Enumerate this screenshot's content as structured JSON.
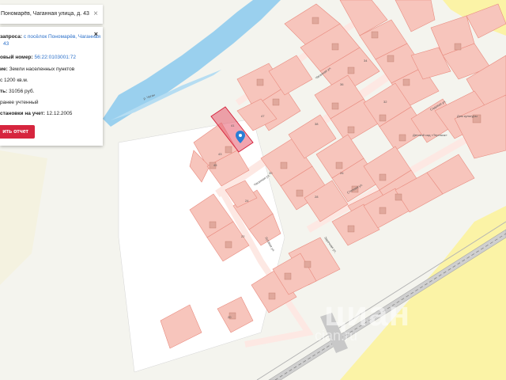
{
  "search": {
    "address": "Пономарёв, Чаганная улица, д. 43",
    "close_icon": "×"
  },
  "panel": {
    "close_icon": "×",
    "request_label": "запроса:",
    "request_value": "с посёлок Пономарёв, Чаганная",
    "request_value2": "43",
    "cadnum_label": "овый номер:",
    "cadnum_value": "56:22:0103001:72",
    "category_label": "ие:",
    "category_value": "Земли населенных пунктов",
    "area_label": "",
    "area_value": "с 1200 кв.м.",
    "cost_label": "ть:",
    "cost_value": "31056 руб.",
    "status_value": "ранее учтенный",
    "date_label": "становки на учет:",
    "date_value": "12.12.2005",
    "button_label": "ить отчет"
  },
  "map_labels": {
    "street1": "Чаганная ул.",
    "street2": "Чаганная ул.",
    "street3": "Степная ул.",
    "street4": "Садовая ул.",
    "street5": "Луговая ул.",
    "street6": "Заречная ул.",
    "river": "р. Чаган",
    "poi1": "Детский сад «Теремок»",
    "poi2": "Дом культуры",
    "n1": "41",
    "n2": "43",
    "n3": "45",
    "n4": "47",
    "n5": "38",
    "n6": "36",
    "n7": "34",
    "n8": "32",
    "n9": "30",
    "n10": "28",
    "n11": "26",
    "n12": "24",
    "n13": "22",
    "n14": "20"
  },
  "watermark": {
    "main": "циан",
    "sub": "cian.ru"
  },
  "colors": {
    "parcel": "#f7c5bc",
    "parcel_stroke": "#e88a7e",
    "selected": "#e65a6e",
    "river": "#9ad0ee",
    "field": "#fbf3a6",
    "button": "#d6253e",
    "pin": "#2a7ed6"
  }
}
